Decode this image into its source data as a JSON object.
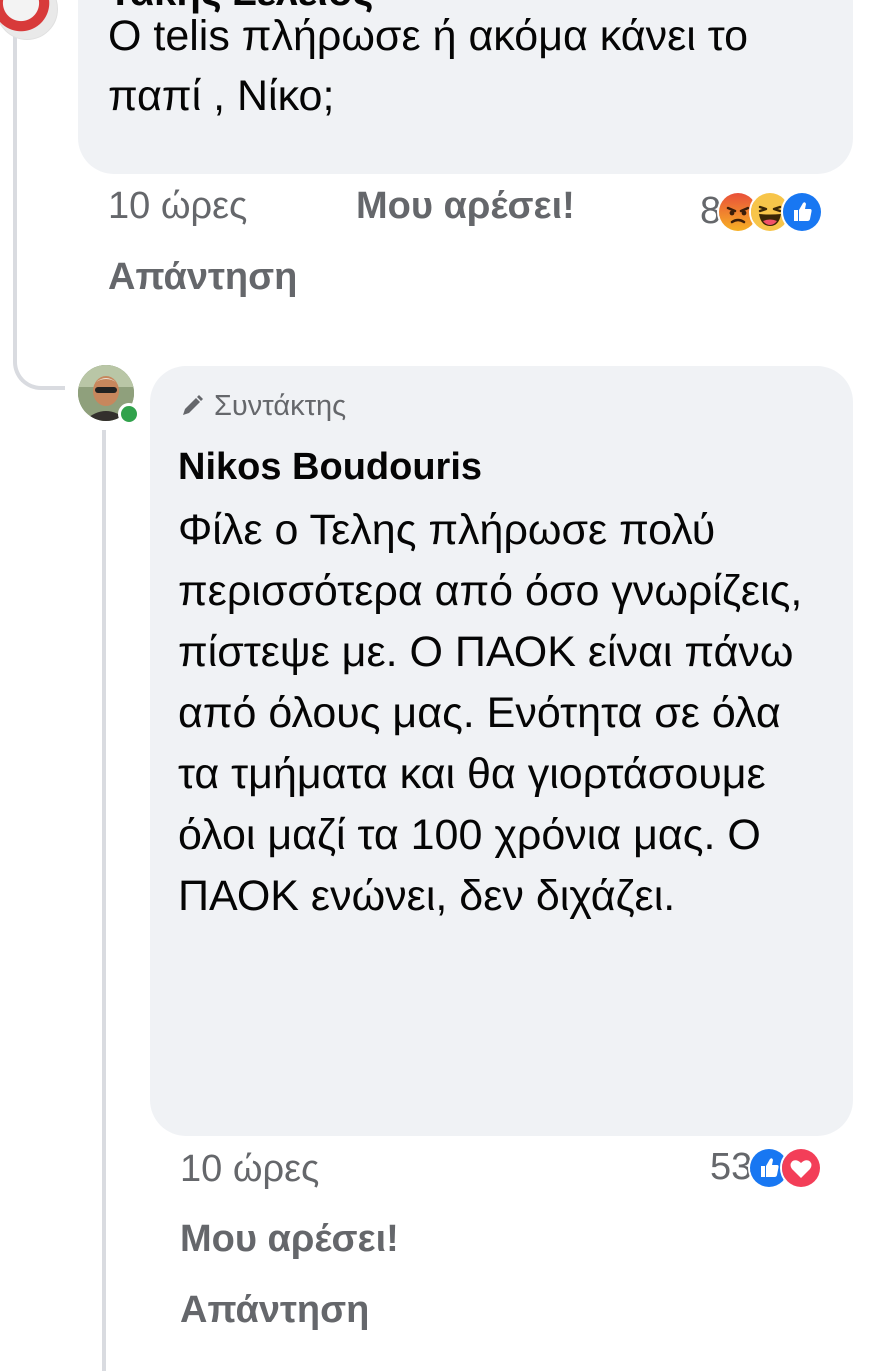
{
  "comments": [
    {
      "author": "Τάκης Σελειος",
      "text": "Ο telis πλήρωσε ή ακόμα κάνει το παπί  , Νίκο;",
      "time": "10 ώρες",
      "like_label": "Μου αρέσει!",
      "reply_label": "Απάντηση",
      "reaction_count": "8",
      "reactions": [
        "angry-icon",
        "haha-icon",
        "like-icon"
      ]
    },
    {
      "role_label": "Συντάκτης",
      "author": "Nikos Boudouris",
      "text": "Φίλε ο Τελης πλήρωσε πολύ περισσότερα από όσο γνωρίζεις, πίστεψε με. Ο ΠΑΟΚ είναι πάνω από όλους μας. Ενότητα σε όλα τα τμήματα και θα γιορτάσουμε όλοι μαζί τα 100 χρόνια μας. Ο ΠΑΟΚ ενώνει, δεν διχάζει.",
      "time": "10 ώρες",
      "like_label": "Μου αρέσει!",
      "reply_label": "Απάντηση",
      "reaction_count": "53",
      "reactions": [
        "like-icon",
        "love-icon"
      ],
      "online": true
    }
  ],
  "colors": {
    "bubble": "#f0f2f5",
    "secondary_text": "#65676b",
    "primary_text": "#050505",
    "like_blue": "#1877f2",
    "love_red": "#f33e58",
    "online_green": "#31a24c"
  }
}
